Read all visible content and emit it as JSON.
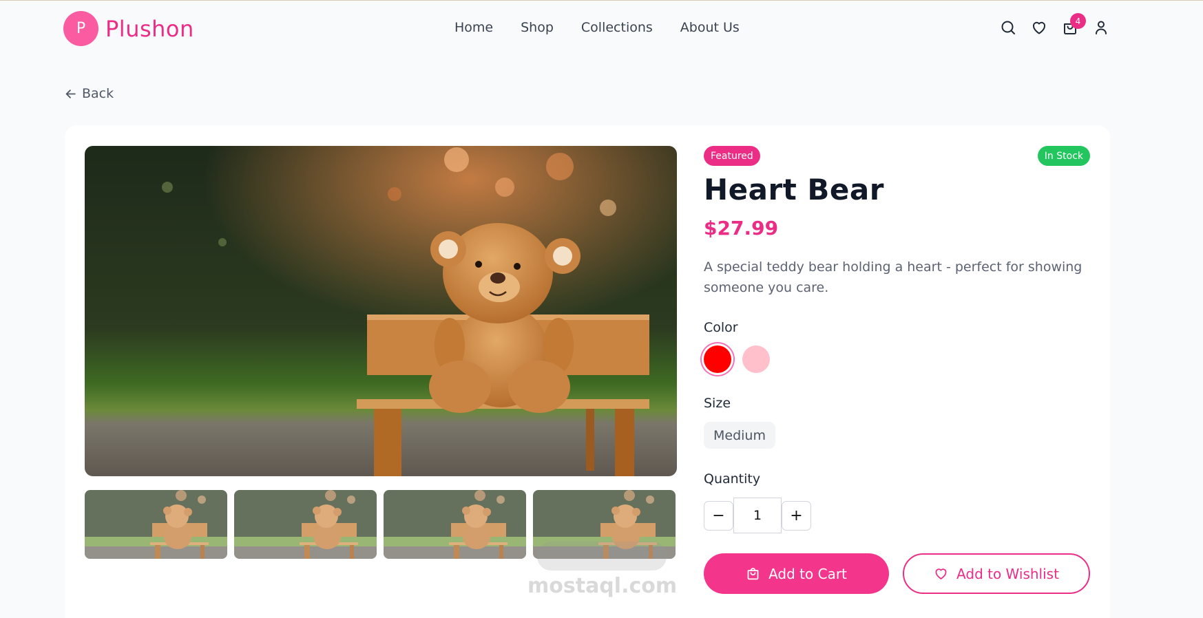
{
  "brand": {
    "logo_letter": "P",
    "name": "Plushon"
  },
  "nav": {
    "items": [
      "Home",
      "Shop",
      "Collections",
      "About Us"
    ]
  },
  "header_icons": [
    "search-icon",
    "heart-icon",
    "shopping-bag-icon",
    "user-icon"
  ],
  "cart": {
    "count": "4"
  },
  "back": {
    "label": "Back"
  },
  "product": {
    "badge": "Featured",
    "stock": "In Stock",
    "title": "Heart Bear",
    "price": "$27.99",
    "description": "A special teddy bear holding a heart - perfect for showing someone you care.",
    "color_label": "Color",
    "colors": [
      "#ff0000",
      "#ffc0cb"
    ],
    "selected_color": "#ff0000",
    "size_label": "Size",
    "size": "Medium",
    "quantity_label": "Quantity",
    "quantity": "1",
    "minus": "−",
    "plus": "+",
    "add_to_cart": "Add to Cart",
    "add_to_wishlist": "Add to Wishlist",
    "thumbnail_count": 4
  },
  "watermark": {
    "text": "mostaql.com"
  },
  "colors": {
    "accent": "#ec2d86",
    "stock": "#22c55e",
    "background": "#f8fafc"
  }
}
